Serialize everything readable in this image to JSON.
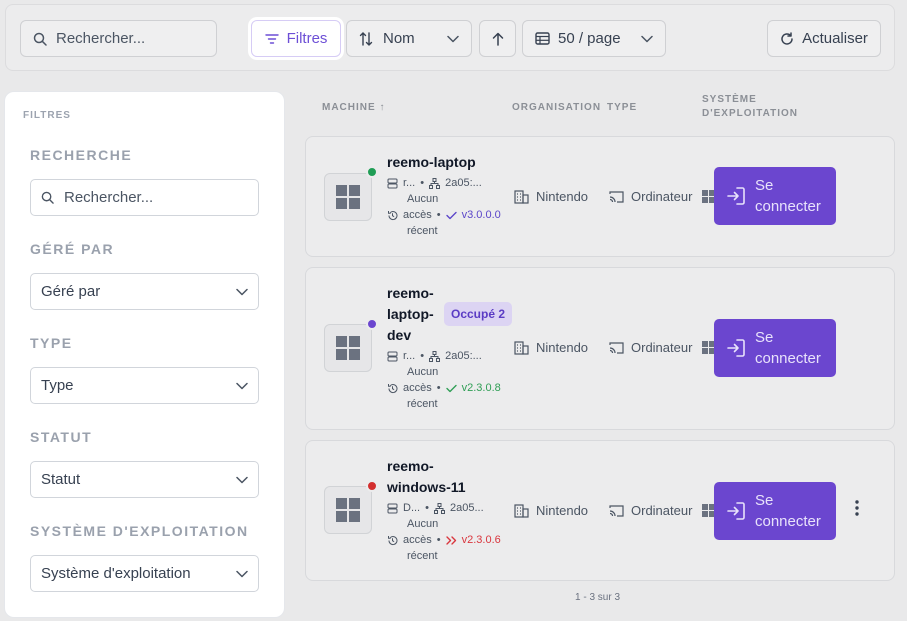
{
  "toolbar": {
    "search_placeholder": "Rechercher...",
    "filters_label": "Filtres",
    "sort_label": "Nom",
    "page_size_label": "50 / page",
    "refresh_label": "Actualiser"
  },
  "columns": {
    "machine": "MACHINE",
    "organisation": "ORGANISATION",
    "type": "TYPE",
    "os_line1": "SYSTÈME",
    "os_line2": "D'EXPLOITATION"
  },
  "machines": [
    {
      "name_lines": [
        "reemo-laptop"
      ],
      "status_color": "#1f9d55",
      "user": "r...",
      "ip": "2a05:...",
      "access_lines": [
        "Aucun",
        "accès",
        "récent"
      ],
      "version": "v3.0.0.0",
      "version_color": "#5b46c9",
      "version_icon": "check-icon",
      "organisation": "Nintendo",
      "type": "Ordinateur",
      "connect_label_1": "Se",
      "connect_label_2": "connecter"
    },
    {
      "name_lines": [
        "reemo-",
        "laptop-",
        "dev"
      ],
      "status_color": "#6b46cf",
      "badge": "Occupé 2",
      "user": "r...",
      "ip": "2a05:...",
      "access_lines": [
        "Aucun",
        "accès",
        "récent"
      ],
      "version": "v2.3.0.8",
      "version_color": "#2f9e55",
      "version_icon": "check-icon",
      "organisation": "Nintendo",
      "type": "Ordinateur",
      "connect_label_1": "Se",
      "connect_label_2": "connecter"
    },
    {
      "name_lines": [
        "reemo-",
        "windows-11"
      ],
      "status_color": "#d32f2f",
      "user": "D...",
      "ip": "2a05...",
      "access_lines": [
        "Aucun",
        "accès",
        "récent"
      ],
      "version": "v2.3.0.6",
      "version_color": "#d9363e",
      "version_icon": "double-chevron-right-icon",
      "organisation": "Nintendo",
      "type": "Ordinateur",
      "connect_label_1": "Se",
      "connect_label_2": "connecter"
    }
  ],
  "pagination": {
    "label": "1 - 3 sur 3"
  },
  "filters": {
    "title": "FILTRES",
    "search": {
      "label": "RECHERCHE",
      "placeholder": "Rechercher..."
    },
    "managed_by": {
      "label": "GÉRÉ PAR",
      "value": "Géré par"
    },
    "type": {
      "label": "TYPE",
      "value": "Type"
    },
    "status": {
      "label": "STATUT",
      "value": "Statut"
    },
    "os": {
      "label": "SYSTÈME D'EXPLOITATION",
      "value": "Système d'exploitation"
    }
  }
}
